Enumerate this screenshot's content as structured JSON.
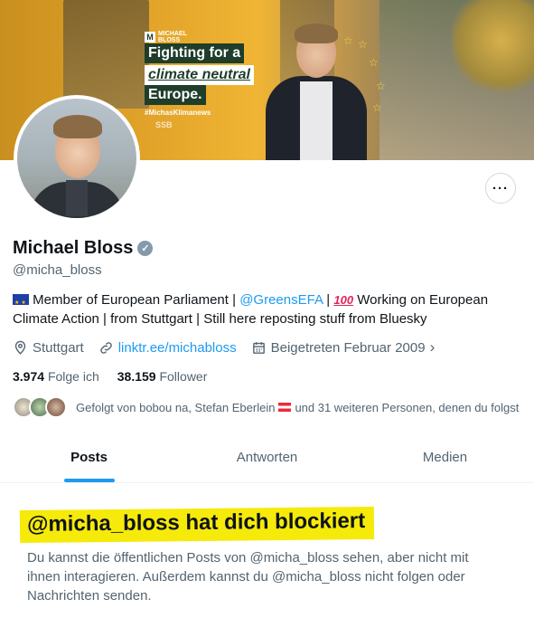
{
  "banner": {
    "ad_brand": "MICHAEL BLOSS",
    "ad_monogram": "M",
    "ad_line1": "Fighting for a",
    "ad_line2": "climate neutral",
    "ad_line3": "Europe.",
    "ad_hashtag": "#MichasKlimanews",
    "ad_bus_text": "SSB"
  },
  "profile": {
    "name": "Michael Bloss",
    "handle": "@micha_bloss",
    "bio": {
      "part1": " Member of European Parliament | ",
      "mention": "@GreensEFA",
      "part2": " | ",
      "emoji_100": "100",
      "part3": " Working on European Climate Action | from Stuttgart | Still here reposting stuff from Bluesky"
    },
    "location": "Stuttgart",
    "website": "linktr.ee/michabloss",
    "joined": "Beigetreten Februar 2009",
    "following_count": "3.974",
    "following_label": "Folge ich",
    "followers_count": "38.159",
    "followers_label": "Follower",
    "followed_by_part1": "Gefolgt von bobou na, Stefan Eberlein",
    "followed_by_part2": "und 31 weiteren Personen, denen du folgst",
    "more_button": "···"
  },
  "tabs": [
    {
      "label": "Posts",
      "active": true
    },
    {
      "label": "Antworten",
      "active": false
    },
    {
      "label": "Medien",
      "active": false
    }
  ],
  "blocked": {
    "title": "@micha_bloss hat dich blockiert",
    "text": "Du kannst die öffentlichen Posts von @micha_bloss sehen, aber nicht mit ihnen interagieren. Außerdem kannst du @micha_bloss nicht folgen oder Nachrichten senden."
  },
  "colors": {
    "accent": "#1d9bf0",
    "verified_badge": "#829aab",
    "highlight": "#f6ea0a",
    "secondary_text": "#536471"
  },
  "icons": [
    "location-pin-icon",
    "link-icon",
    "calendar-icon",
    "chevron-right-icon",
    "verified-badge-icon",
    "more-icon",
    "eu-flag-icon",
    "hundred-points-icon",
    "austria-flag-icon"
  ]
}
